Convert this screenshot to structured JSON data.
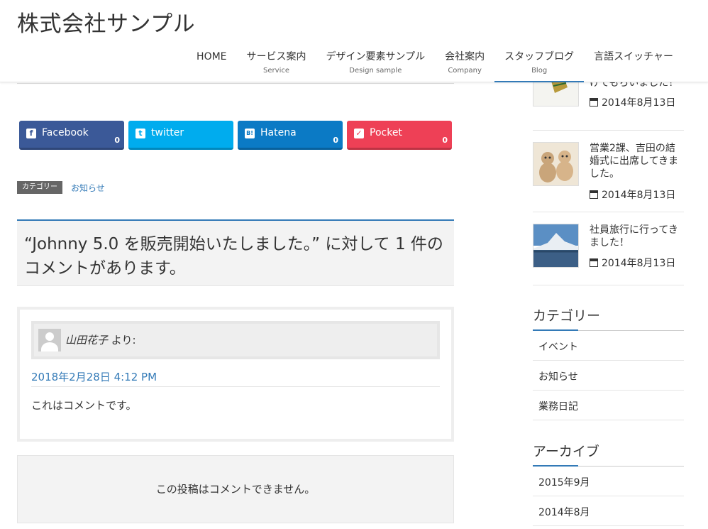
{
  "header": {
    "site_title": "株式会社サンプル",
    "nav": [
      {
        "label": "HOME",
        "sub": ""
      },
      {
        "label": "サービス案内",
        "sub": "Service"
      },
      {
        "label": "デザイン要素サンプル",
        "sub": "Design sample"
      },
      {
        "label": "会社案内",
        "sub": "Company"
      },
      {
        "label": "スタッフブログ",
        "sub": "Blog"
      },
      {
        "label": "言語スイッチャー",
        "sub": ""
      }
    ],
    "active_nav": "スタッフブログ"
  },
  "share": {
    "facebook": {
      "label": "Facebook",
      "count": "0",
      "icon": "facebook-icon",
      "color": "#3b5998"
    },
    "twitter": {
      "label": "twitter",
      "count": "",
      "icon": "twitter-icon",
      "color": "#00acee"
    },
    "hatena": {
      "label": "Hatena",
      "count": "0",
      "icon": "hatena-icon",
      "color": "#0b7ac5"
    },
    "pocket": {
      "label": "Pocket",
      "count": "0",
      "icon": "pocket-icon",
      "color": "#ee4056"
    }
  },
  "category": {
    "label": "カテゴリー",
    "value": "お知らせ"
  },
  "comments": {
    "title": "“Johnny 5.0 を販売開始いたしました。” に対して 1 件のコメントがあります。",
    "items": [
      {
        "author": "山田花子",
        "says": "より:",
        "date": "2018年2月28日 4:12 PM",
        "body": "これはコメントです。"
      }
    ],
    "closed_notice": "この投稿はコメントできません。"
  },
  "sidebar": {
    "posts": [
      {
        "title": "て、見えく言えをかけてもらいました！",
        "date": "2014年8月13日",
        "thumb": "broom"
      },
      {
        "title": "営業2課、吉田の結婚式に出席してきました。",
        "date": "2014年8月13日",
        "thumb": "teddy-bears"
      },
      {
        "title": "社員旅行に行ってきました！",
        "date": "2014年8月13日",
        "thumb": "mount-fuji"
      }
    ],
    "category_title": "カテゴリー",
    "categories": [
      "イベント",
      "お知らせ",
      "業務日記"
    ],
    "archive_title": "アーカイブ",
    "archives": [
      "2015年9月",
      "2014年8月"
    ]
  },
  "colors": {
    "accent": "#337ab7",
    "text": "#333333",
    "panel": "#f3f3f3"
  }
}
